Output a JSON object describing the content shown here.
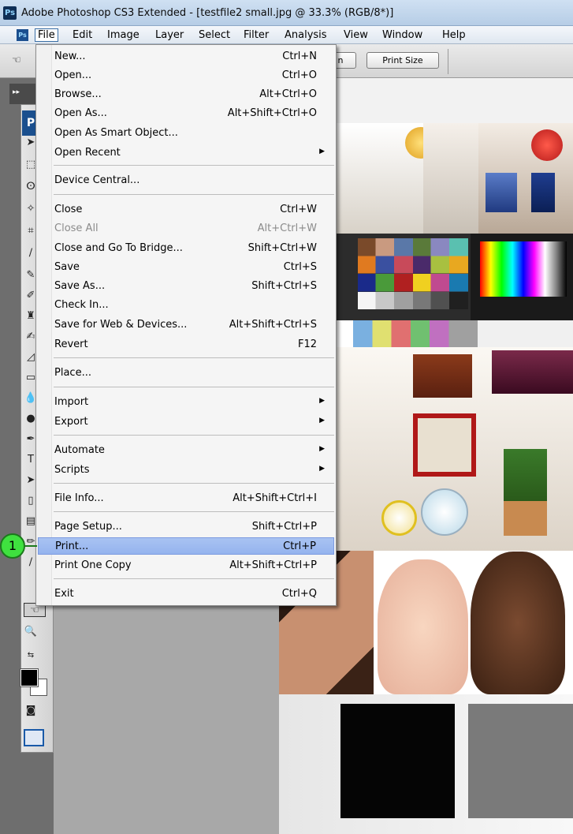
{
  "window": {
    "app_icon": "Ps",
    "title": "Adobe Photoshop CS3 Extended - [testfile2 small.jpg @ 33.3% (RGB/8*)]"
  },
  "menubar": {
    "app_mini_icon": "Ps",
    "items": [
      "File",
      "Edit",
      "Image",
      "Layer",
      "Select",
      "Filter",
      "Analysis",
      "View",
      "Window",
      "Help"
    ],
    "active": "File"
  },
  "optionsbar": {
    "partial_button_label": "n",
    "print_size_label": "Print Size"
  },
  "toolbox": {
    "badge": "P",
    "colors": {
      "foreground": "#000000",
      "background": "#ffffff"
    }
  },
  "file_menu": {
    "items": [
      {
        "label": "New...",
        "shortcut": "Ctrl+N"
      },
      {
        "label": "Open...",
        "shortcut": "Ctrl+O"
      },
      {
        "label": "Browse...",
        "shortcut": "Alt+Ctrl+O"
      },
      {
        "label": "Open As...",
        "shortcut": "Alt+Shift+Ctrl+O"
      },
      {
        "label": "Open As Smart Object...",
        "shortcut": ""
      },
      {
        "label": "Open Recent",
        "shortcut": "",
        "submenu": true
      },
      {
        "label": "Device Central...",
        "shortcut": ""
      },
      {
        "label": "Close",
        "shortcut": "Ctrl+W"
      },
      {
        "label": "Close All",
        "shortcut": "Alt+Ctrl+W",
        "disabled": true
      },
      {
        "label": "Close and Go To Bridge...",
        "shortcut": "Shift+Ctrl+W"
      },
      {
        "label": "Save",
        "shortcut": "Ctrl+S"
      },
      {
        "label": "Save As...",
        "shortcut": "Shift+Ctrl+S"
      },
      {
        "label": "Check In...",
        "shortcut": ""
      },
      {
        "label": "Save for Web & Devices...",
        "shortcut": "Alt+Shift+Ctrl+S"
      },
      {
        "label": "Revert",
        "shortcut": "F12"
      },
      {
        "label": "Place...",
        "shortcut": ""
      },
      {
        "label": "Import",
        "shortcut": "",
        "submenu": true
      },
      {
        "label": "Export",
        "shortcut": "",
        "submenu": true
      },
      {
        "label": "Automate",
        "shortcut": "",
        "submenu": true
      },
      {
        "label": "Scripts",
        "shortcut": "",
        "submenu": true
      },
      {
        "label": "File Info...",
        "shortcut": "Alt+Shift+Ctrl+I"
      },
      {
        "label": "Page Setup...",
        "shortcut": "Shift+Ctrl+P"
      },
      {
        "label": "Print...",
        "shortcut": "Ctrl+P",
        "highlighted": true
      },
      {
        "label": "Print One Copy",
        "shortcut": "Alt+Shift+Ctrl+P"
      },
      {
        "label": "Exit",
        "shortcut": "Ctrl+Q"
      }
    ]
  },
  "callout": {
    "number": "1"
  },
  "theme": {
    "highlight": "#9db9f0",
    "menu_bg": "#f5f5f5",
    "disabled_text": "#8b8b8b",
    "callout_fill": "#3fe13f"
  }
}
